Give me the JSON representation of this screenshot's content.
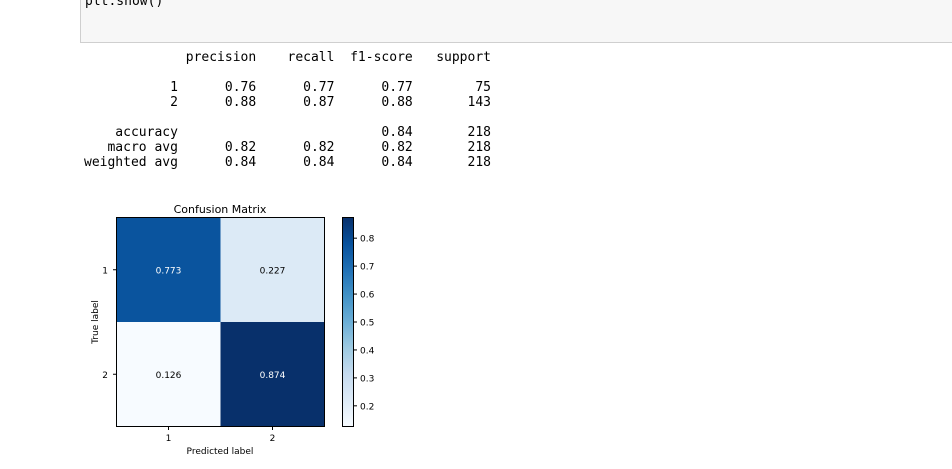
{
  "code_cell": {
    "visible_code": "plt.show()"
  },
  "report": {
    "header": [
      "",
      "precision",
      "recall",
      "f1-score",
      "support"
    ],
    "class_rows": [
      [
        "1",
        "0.76",
        "0.77",
        "0.77",
        "75"
      ],
      [
        "2",
        "0.88",
        "0.87",
        "0.88",
        "143"
      ]
    ],
    "summary_rows": [
      [
        "accuracy",
        "",
        "",
        "0.84",
        "218"
      ],
      [
        "macro avg",
        "0.82",
        "0.82",
        "0.82",
        "218"
      ],
      [
        "weighted avg",
        "0.84",
        "0.84",
        "0.84",
        "218"
      ]
    ]
  },
  "chart_data": {
    "type": "heatmap",
    "title": "Confusion Matrix",
    "xlabel": "Predicted label",
    "ylabel": "True label",
    "x_categories": [
      "1",
      "2"
    ],
    "y_categories": [
      "1",
      "2"
    ],
    "values": [
      [
        0.773,
        0.227
      ],
      [
        0.126,
        0.874
      ]
    ],
    "value_labels": [
      [
        "0.773",
        "0.227"
      ],
      [
        "0.126",
        "0.874"
      ]
    ],
    "colormap": "Blues",
    "colorbar_range": [
      0.126,
      0.874
    ],
    "colorbar_ticks": [
      "0.2",
      "0.3",
      "0.4",
      "0.5",
      "0.6",
      "0.7",
      "0.8"
    ],
    "colors": {
      "light": "#f7fbff",
      "dark": "#08306b",
      "text_light_cells": "#000000",
      "text_dark_cells": "#ffffff"
    }
  }
}
